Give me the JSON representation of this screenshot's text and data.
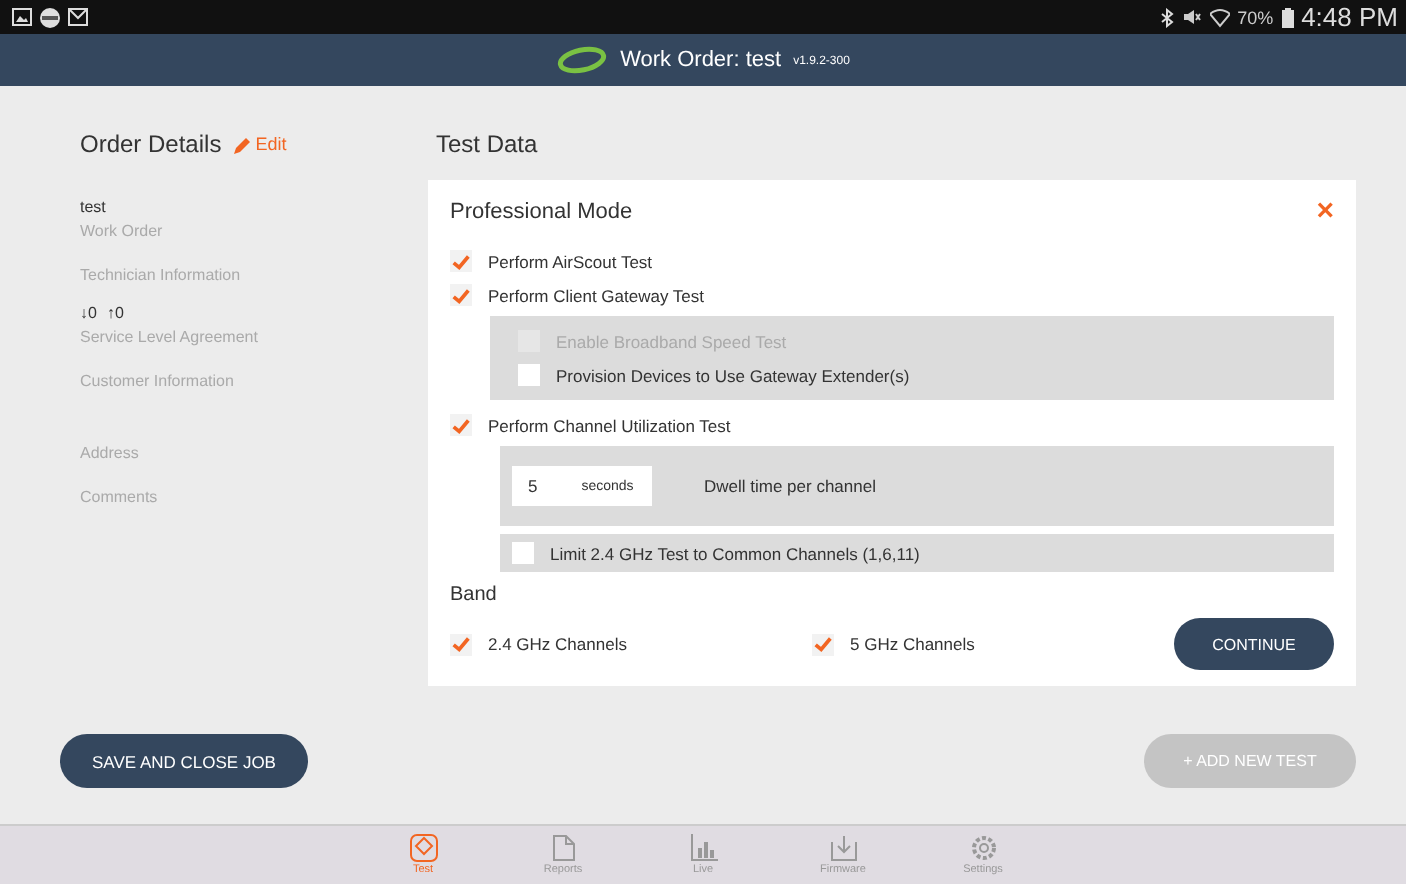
{
  "status_bar": {
    "battery": "70%",
    "time": "4:48 PM"
  },
  "header": {
    "title": "Work Order: test",
    "version": "v1.9.2-300"
  },
  "order_details": {
    "title": "Order Details",
    "edit": "Edit",
    "fields": [
      {
        "value": "test",
        "label": "Work Order"
      },
      {
        "label": "Technician Information"
      },
      {
        "download": "↓0",
        "upload": "↑0",
        "label": "Service Level Agreement"
      },
      {
        "label": "Customer Information"
      },
      {
        "label": "Address",
        "gap": true
      },
      {
        "label": "Comments"
      }
    ]
  },
  "test_data": {
    "title": "Test Data"
  },
  "card": {
    "title": "Professional Mode",
    "close": "×",
    "airscout": {
      "label": "Perform AirScout Test",
      "checked": true
    },
    "gateway": {
      "label": "Perform Client Gateway Test",
      "checked": true,
      "options": [
        {
          "label": "Enable Broadband Speed Test",
          "checked": false,
          "disabled": true
        },
        {
          "label": "Provision Devices to Use Gateway Extender(s)",
          "checked": false,
          "disabled": false
        }
      ]
    },
    "channel": {
      "label": "Perform Channel Utilization Test",
      "checked": true
    },
    "dwell": {
      "value": "5",
      "unit": "seconds",
      "label": "Dwell time per channel"
    },
    "limit": {
      "label": "Limit 2.4 GHz Test to Common Channels (1,6,11)",
      "checked": false
    },
    "band": {
      "title": "Band",
      "options": [
        {
          "label": "2.4 GHz Channels",
          "checked": true
        },
        {
          "label": "5 GHz Channels",
          "checked": true
        }
      ]
    },
    "continue": "CONTINUE"
  },
  "save_button": "SAVE AND CLOSE JOB",
  "add_button": {
    "label": "+ ADD NEW TEST",
    "disabled": true
  },
  "nav": [
    {
      "label": "Test",
      "kind": "test",
      "selected": true
    },
    {
      "label": "Reports",
      "kind": "reports",
      "selected": false
    },
    {
      "label": "Live",
      "kind": "live",
      "selected": false
    },
    {
      "label": "Firmware",
      "kind": "firmware",
      "selected": false
    },
    {
      "label": "Settings",
      "kind": "settings",
      "selected": false
    }
  ]
}
